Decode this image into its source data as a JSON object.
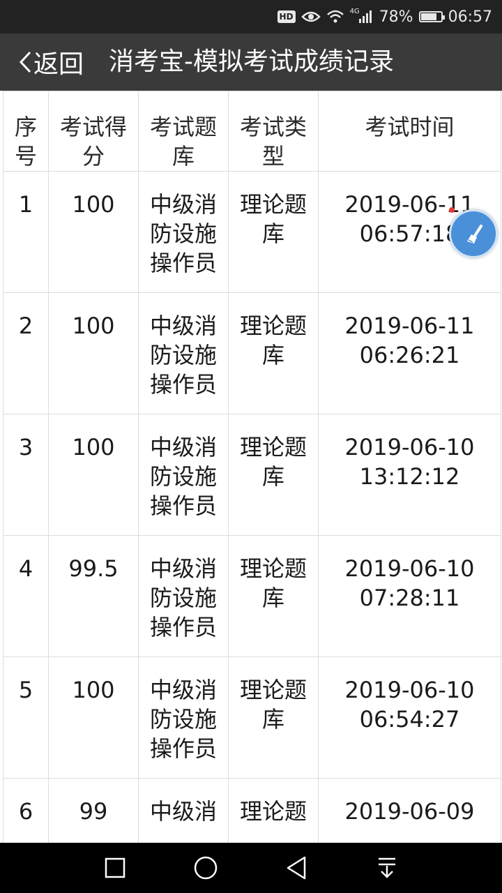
{
  "status_bar": {
    "hd_label": "HD",
    "network": "4G",
    "battery": "78%",
    "battery_level": 0.78,
    "time": "06:57"
  },
  "header": {
    "back_label": "返回",
    "title": "消考宝-模拟考试成绩记录"
  },
  "table": {
    "columns": [
      "序号",
      "考试得分",
      "考试题库",
      "考试类型",
      "考试时间"
    ],
    "rows": [
      {
        "no": "1",
        "score": "100",
        "bank": "中级消防设施操作员",
        "type": "理论题库",
        "date": "2019-06-11",
        "time": "06:57:18"
      },
      {
        "no": "2",
        "score": "100",
        "bank": "中级消防设施操作员",
        "type": "理论题库",
        "date": "2019-06-11",
        "time": "06:26:21"
      },
      {
        "no": "3",
        "score": "100",
        "bank": "中级消防设施操作员",
        "type": "理论题库",
        "date": "2019-06-10",
        "time": "13:12:12"
      },
      {
        "no": "4",
        "score": "99.5",
        "bank": "中级消防设施操作员",
        "type": "理论题库",
        "date": "2019-06-10",
        "time": "07:28:11"
      },
      {
        "no": "5",
        "score": "100",
        "bank": "中级消防设施操作员",
        "type": "理论题库",
        "date": "2019-06-10",
        "time": "06:54:27"
      },
      {
        "no": "6",
        "score": "99",
        "bank": "中级消",
        "type": "理论题",
        "date": "2019-06-09",
        "time": ""
      }
    ]
  },
  "colors": {
    "status_bar_bg": "#222222",
    "title_bar_bg": "#3a3a3a",
    "border": "#dcdcdc",
    "fab": "#4a90d9"
  },
  "icons": {
    "floating_button": "broom-clean-icon",
    "nav": [
      "square-recents-icon",
      "circle-home-icon",
      "triangle-back-icon",
      "notification-pulldown-icon"
    ]
  }
}
